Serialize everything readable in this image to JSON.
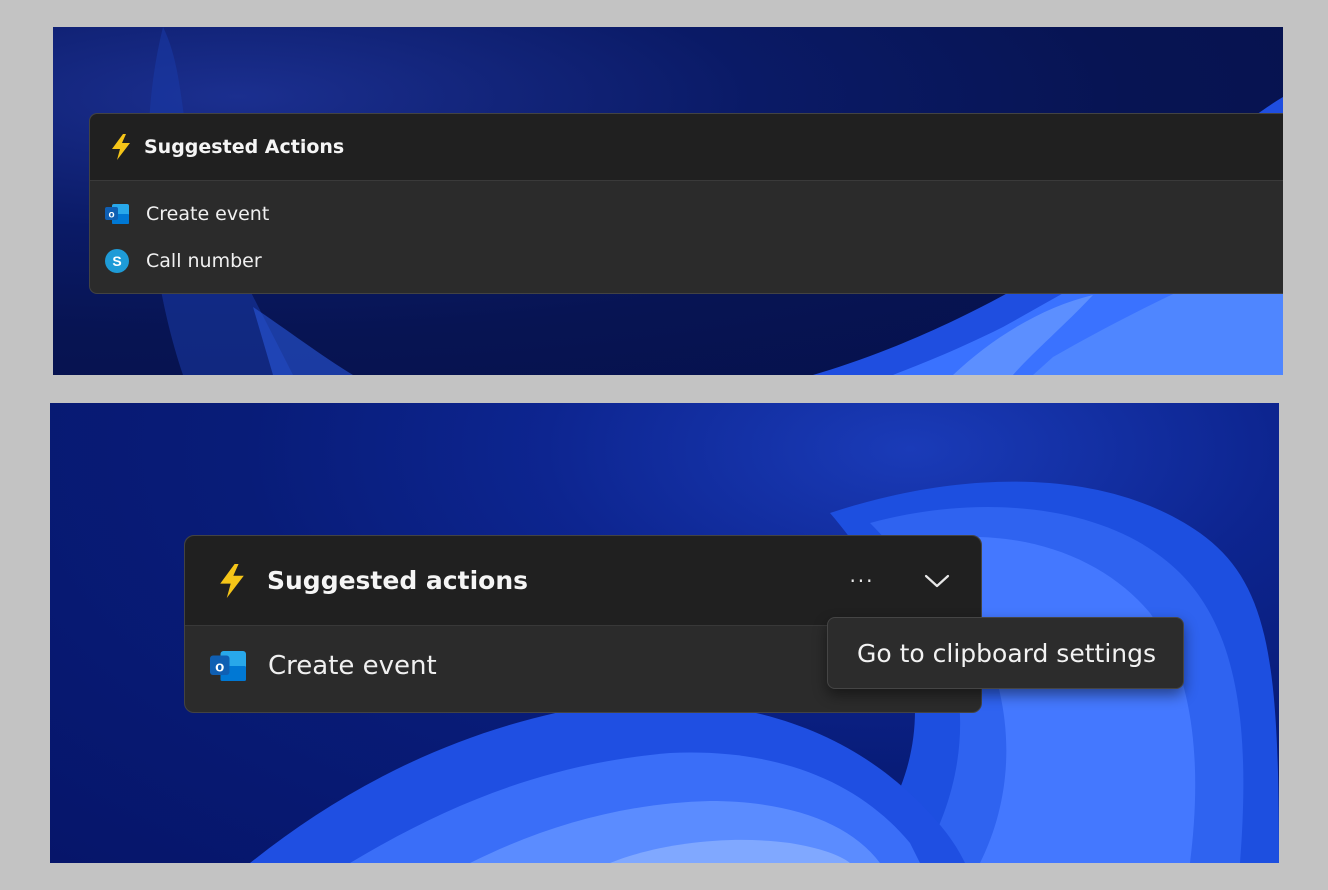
{
  "top_screenshot": {
    "header": {
      "title": "Suggested Actions",
      "icon": "lightning-icon"
    },
    "actions": [
      {
        "label": "Create event",
        "icon": "outlook-icon"
      },
      {
        "label": "Call number",
        "icon": "skype-icon"
      }
    ]
  },
  "bottom_screenshot": {
    "header": {
      "title": "Suggested actions",
      "icon": "lightning-icon",
      "more_label": "···",
      "collapse_icon": "chevron-down-icon"
    },
    "actions": [
      {
        "label": "Create event",
        "icon": "outlook-icon"
      }
    ],
    "tooltip": {
      "label": "Go to clipboard settings"
    }
  },
  "colors": {
    "panel_bg": "#2b2b2b",
    "header_bg": "#202020",
    "accent_lightning": "#f5c518",
    "outlook_blue": "#0f6cbd",
    "skype_blue": "#1e9bd7"
  }
}
